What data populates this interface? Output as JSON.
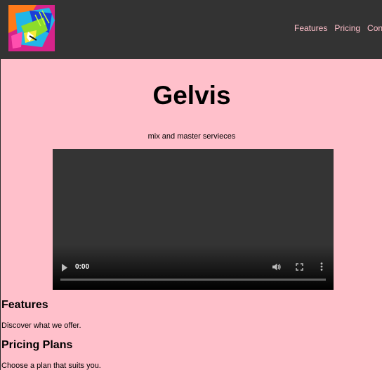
{
  "nav": {
    "logo": "gelvis-logo",
    "links": [
      "Features",
      "Pricing",
      "Contact"
    ]
  },
  "hero": {
    "title": "Gelvis",
    "subtitle": "mix and master servieces"
  },
  "video": {
    "time": "0:00",
    "progress": 0,
    "icons": [
      "play-icon",
      "volume-icon",
      "fullscreen-icon",
      "more-options-icon"
    ]
  },
  "sections": [
    {
      "title": "Features",
      "text": "Discover what we offer."
    },
    {
      "title": "Pricing Plans",
      "text": "Choose a plan that suits you."
    }
  ],
  "colors": {
    "page_background": "#ffc0cb",
    "navbar_background": "#333333",
    "nav_link": "#ffc0cb",
    "video_background": "#343434"
  }
}
